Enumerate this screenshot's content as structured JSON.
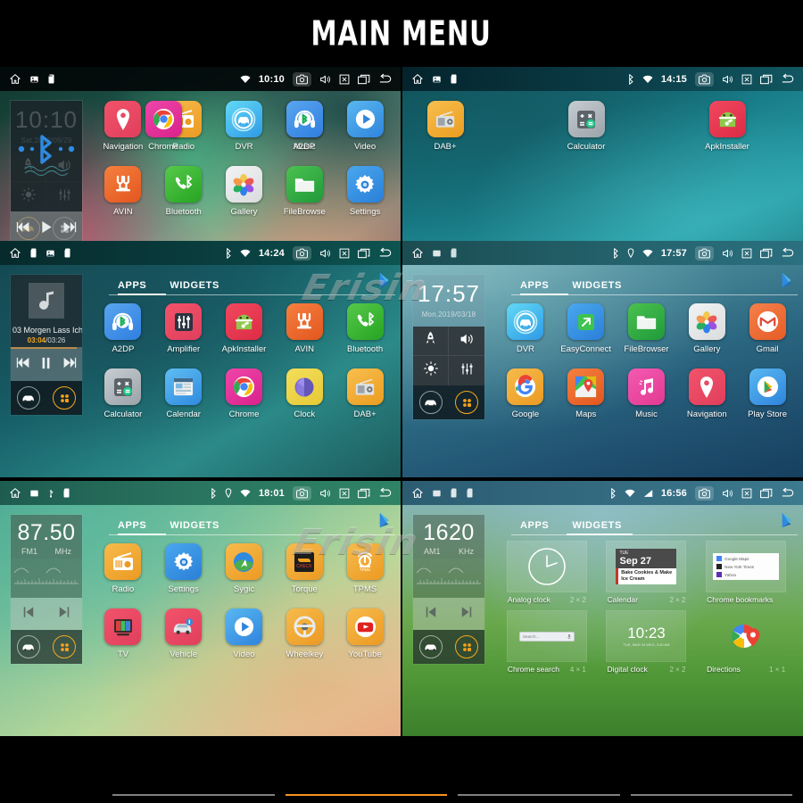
{
  "header": {
    "title": "MAIN MENU"
  },
  "watermark": {
    "text": "Erisin"
  },
  "statusbar_common": {
    "home_icon": "home-icon",
    "camera_icon": "camera-icon",
    "volume_icon": "volume-icon",
    "close_icon": "close-x-icon",
    "recents_icon": "recents-icon",
    "back_icon": "back-icon"
  },
  "panels": [
    {
      "id": "panel-home-main",
      "status": {
        "time": "10:10",
        "icons_left": [
          "image-icon",
          "sd-card-icon"
        ],
        "icons_right": [
          "wifi-icon"
        ]
      },
      "widget": {
        "type": "clock-shortcuts",
        "time": "10:10",
        "date": "Sat,2018/09/29",
        "shortcuts": [
          "rocket-icon",
          "volume-loud-icon",
          "brightness-icon",
          "equalizer-icon"
        ],
        "dock": [
          "car-icon",
          "apps-grid-icon"
        ],
        "dock_active": "car-icon"
      },
      "apps_row1": [
        {
          "label": "Navigation",
          "icon": "navigation-pin-icon"
        },
        {
          "label": "Radio",
          "icon": "radio-icon"
        },
        {
          "label": "DVR",
          "icon": "dvr-car-icon"
        },
        {
          "label": "Music",
          "icon": "music-note-icon"
        },
        {
          "label": "Video",
          "icon": "video-play-icon"
        }
      ],
      "apps_row2": [
        {
          "label": "AVIN",
          "icon": "avin-plug-icon"
        },
        {
          "label": "Bluetooth",
          "icon": "bluetooth-phone-icon"
        },
        {
          "label": "Gallery",
          "icon": "gallery-flower-icon"
        },
        {
          "label": "FileBrowse",
          "icon": "folder-icon"
        },
        {
          "label": "Settings",
          "icon": "gear-icon"
        }
      ],
      "page_indicator": {
        "count": 4,
        "active": 0
      }
    },
    {
      "id": "panel-home-bluetooth",
      "status": {
        "time": "14:15",
        "icons_left": [
          "image-icon",
          "sd-card-icon"
        ],
        "icons_right": [
          "bluetooth-icon",
          "wifi-icon"
        ]
      },
      "widget": {
        "type": "bluetooth-player",
        "icon": "bluetooth-icon",
        "transport": [
          "prev-icon",
          "play-icon",
          "next-icon"
        ],
        "dock": [
          "car-icon",
          "apps-grid-icon"
        ],
        "dock_active": "car-icon"
      },
      "apps_row1": [
        {
          "label": "Chrome",
          "icon": "chrome-icon"
        },
        {
          "label": "A2DP",
          "icon": "a2dp-headset-icon"
        },
        {
          "label": "DAB+",
          "icon": "dab-radio-icon"
        },
        {
          "label": "Calculator",
          "icon": "calculator-icon"
        },
        {
          "label": "ApkInstaller",
          "icon": "apk-installer-icon"
        }
      ],
      "apps_row2": [],
      "page_indicator": {
        "count": 4,
        "active": 1
      }
    },
    {
      "id": "panel-app-drawer-music",
      "status": {
        "time": "14:24",
        "icons_left": [
          "sd-card-icon",
          "image-icon",
          "sd-card-icon"
        ],
        "icons_right": [
          "bluetooth-icon",
          "wifi-icon"
        ]
      },
      "widget": {
        "type": "music-player",
        "track": "03 Morgen Lass Ich",
        "position": "03:04",
        "duration": "03:26",
        "album_icon": "music-note-icon",
        "transport": [
          "prev-icon",
          "pause-icon",
          "next-icon"
        ],
        "dock": [
          "car-icon",
          "apps-grid-icon"
        ],
        "dock_active": "apps-grid-icon"
      },
      "tabs": {
        "items": [
          "APPS",
          "WIDGETS"
        ],
        "active": 0,
        "play_store_icon": "play-store-icon"
      },
      "apps_row1": [
        {
          "label": "A2DP",
          "icon": "a2dp-headset-icon"
        },
        {
          "label": "Amplifier",
          "icon": "amplifier-icon"
        },
        {
          "label": "ApkInstaller",
          "icon": "apk-installer-icon"
        },
        {
          "label": "AVIN",
          "icon": "avin-plug-icon"
        },
        {
          "label": "Bluetooth",
          "icon": "bluetooth-phone-icon"
        }
      ],
      "apps_row2": [
        {
          "label": "Calculator",
          "icon": "calculator-icon"
        },
        {
          "label": "Calendar",
          "icon": "calendar-icon"
        },
        {
          "label": "Chrome",
          "icon": "chrome-icon"
        },
        {
          "label": "Clock",
          "icon": "clock-cube-icon"
        },
        {
          "label": "DAB+",
          "icon": "dab-radio-icon"
        }
      ]
    },
    {
      "id": "panel-app-drawer-clock",
      "status": {
        "time": "17:57",
        "icons_left": [
          "image-icon",
          "sd-card-icon"
        ],
        "icons_right": [
          "bluetooth-icon",
          "location-icon",
          "wifi-icon"
        ]
      },
      "widget": {
        "type": "clock-shortcuts",
        "time": "17:57",
        "date": "Mon,2019/03/18",
        "shortcuts": [
          "rocket-icon",
          "volume-loud-icon",
          "brightness-icon",
          "equalizer-icon"
        ],
        "dock": [
          "car-icon",
          "apps-grid-icon"
        ],
        "dock_active": "apps-grid-icon"
      },
      "tabs": {
        "items": [
          "APPS",
          "WIDGETS"
        ],
        "active": 0,
        "play_store_icon": "play-store-icon"
      },
      "apps_row1": [
        {
          "label": "DVR",
          "icon": "dvr-car-icon"
        },
        {
          "label": "EasyConnect",
          "icon": "easyconnect-icon"
        },
        {
          "label": "FileBrowser",
          "icon": "folder-icon"
        },
        {
          "label": "Gallery",
          "icon": "gallery-flower-icon"
        },
        {
          "label": "Gmail",
          "icon": "gmail-icon"
        }
      ],
      "apps_row2": [
        {
          "label": "Google",
          "icon": "google-g-icon"
        },
        {
          "label": "Maps",
          "icon": "maps-icon"
        },
        {
          "label": "Music",
          "icon": "music-note-icon"
        },
        {
          "label": "Navigation",
          "icon": "navigation-pin-icon"
        },
        {
          "label": "Play Store",
          "icon": "play-store-icon"
        }
      ]
    },
    {
      "id": "panel-app-drawer-fm",
      "status": {
        "time": "18:01",
        "icons_left": [
          "image-icon",
          "usb-icon",
          "sd-card-icon"
        ],
        "icons_right": [
          "bluetooth-icon",
          "location-icon",
          "wifi-icon"
        ]
      },
      "widget": {
        "type": "radio",
        "frequency": "87.50",
        "band": "FM1",
        "unit": "MHz",
        "transport": [
          "prev-icon",
          "next-icon"
        ],
        "dock": [
          "car-icon",
          "apps-grid-icon"
        ],
        "dock_active": "apps-grid-icon"
      },
      "tabs": {
        "items": [
          "APPS",
          "WIDGETS"
        ],
        "active": 0,
        "play_store_icon": "play-store-icon"
      },
      "apps_row1": [
        {
          "label": "Radio",
          "icon": "radio-icon"
        },
        {
          "label": "Settings",
          "icon": "gear-icon"
        },
        {
          "label": "Sygic",
          "icon": "sygic-icon"
        },
        {
          "label": "Torque",
          "icon": "torque-icon"
        },
        {
          "label": "TPMS",
          "icon": "tpms-icon"
        }
      ],
      "apps_row2": [
        {
          "label": "TV",
          "icon": "tv-icon"
        },
        {
          "label": "Vehicle",
          "icon": "vehicle-icon"
        },
        {
          "label": "Video",
          "icon": "video-play-icon"
        },
        {
          "label": "Wheelkey",
          "icon": "steering-wheel-icon"
        },
        {
          "label": "YouTube",
          "icon": "youtube-icon"
        }
      ]
    },
    {
      "id": "panel-widgets-am",
      "status": {
        "time": "16:56",
        "icons_left": [
          "image-icon",
          "sd-card-icon",
          "sd-card-icon"
        ],
        "icons_right": [
          "bluetooth-icon",
          "wifi-icon",
          "signal-icon"
        ]
      },
      "widget": {
        "type": "radio",
        "frequency": "1620",
        "band": "AM1",
        "unit": "KHz",
        "transport": [
          "prev-icon",
          "next-icon"
        ],
        "dock": [
          "car-icon",
          "apps-grid-icon"
        ],
        "dock_active": "apps-grid-icon"
      },
      "tabs": {
        "items": [
          "APPS",
          "WIDGETS"
        ],
        "active": 1,
        "play_store_icon": "play-store-icon"
      },
      "widgets_row1": [
        {
          "label": "Analog clock",
          "size": "2 × 2",
          "preview": "analog-clock-preview"
        },
        {
          "label": "Calendar",
          "size": "2 × 2",
          "preview": "calendar-preview",
          "day": "TUE",
          "date": "Sep 27",
          "event": "Bake Cookies & Make Ice Cream"
        },
        {
          "label": "Chrome bookmarks",
          "size": "",
          "preview": "chrome-bookmarks-preview",
          "items": [
            "Google Maps",
            "New York Times",
            "Yahoo"
          ]
        }
      ],
      "widgets_row2": [
        {
          "label": "Chrome search",
          "size": "4 × 1",
          "preview": "chrome-search-preview",
          "placeholder": "Search..."
        },
        {
          "label": "Digital clock",
          "size": "2 × 2",
          "preview": "digital-clock-preview",
          "time": "10:23",
          "sub": "TUE, MAR 04  WED, 3:30 AM"
        },
        {
          "label": "Directions",
          "size": "1 × 1",
          "preview": "directions-preview"
        }
      ]
    }
  ]
}
